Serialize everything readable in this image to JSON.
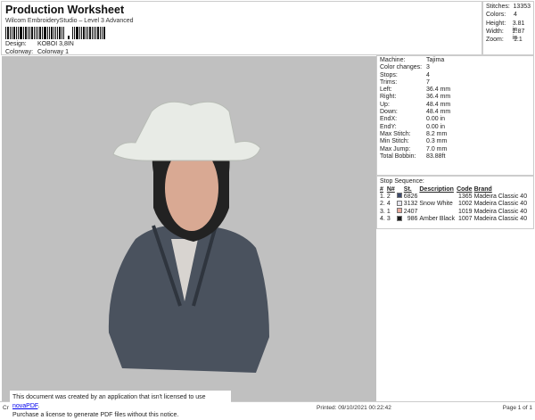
{
  "header": {
    "title": "Production Worksheet",
    "subtitle": "Wilcom EmbroideryStudio – Level 3 Advanced",
    "design_label": "Design:",
    "design_value": "KOBOI 3,8IN",
    "colorway_label": "Colorway:",
    "colorway_value": "Colorway 1"
  },
  "stats": [
    {
      "label": "Stitches:",
      "value": "13353"
    },
    {
      "label": "Colors:",
      "value": "4"
    },
    {
      "label": "Height:",
      "value": "3.81 in"
    },
    {
      "label": "Width:",
      "value": "2.87 in"
    },
    {
      "label": "Zoom:",
      "value": "1:1"
    }
  ],
  "machine": [
    {
      "label": "Machine:",
      "value": "Tajima"
    },
    {
      "label": "Color changes:",
      "value": "3"
    },
    {
      "label": "Stops:",
      "value": "4"
    },
    {
      "label": "Trims:",
      "value": "7"
    },
    {
      "label": "Left:",
      "value": "36.4 mm"
    },
    {
      "label": "Right:",
      "value": "36.4 mm"
    },
    {
      "label": "Up:",
      "value": "48.4 mm"
    },
    {
      "label": "Down:",
      "value": "48.4 mm"
    },
    {
      "label": "EndX:",
      "value": "0.00 in"
    },
    {
      "label": "EndY:",
      "value": "0.00 in"
    },
    {
      "label": "Max Stitch:",
      "value": "8.2 mm"
    },
    {
      "label": "Min Stitch:",
      "value": "0.3 mm"
    },
    {
      "label": "Max Jump:",
      "value": "7.0 mm"
    },
    {
      "label": "Total Bobbin:",
      "value": "83.88ft"
    }
  ],
  "sequence": {
    "title": "Stop Sequence:",
    "headers": [
      "#",
      "N#",
      "St.",
      "Description",
      "Code",
      "Brand"
    ],
    "rows": [
      {
        "n": "1.",
        "nn": "2",
        "color": "#3d4a6b",
        "st": "6826",
        "desc": "",
        "code": "1365",
        "brand": "Madeira Classic 40"
      },
      {
        "n": "2.",
        "nn": "4",
        "color": "#e6e6ee",
        "st": "3132",
        "desc": "Snow White",
        "code": "1002",
        "brand": "Madeira Classic 40"
      },
      {
        "n": "3.",
        "nn": "1",
        "color": "#e8a89a",
        "st": "2407",
        "desc": "",
        "code": "1019",
        "brand": "Madeira Classic 40"
      },
      {
        "n": "4.",
        "nn": "3",
        "color": "#1a1a1a",
        "st": "986",
        "desc": "Amber Black",
        "code": "1007",
        "brand": "Madeira Classic 40"
      }
    ]
  },
  "footer": {
    "left": "Cr",
    "printed": "Printed: 09/10/2021 00:22:42",
    "page": "Page 1 of 1"
  },
  "notice": {
    "line1": "This document was created by an application that isn't licensed to use ",
    "link": "novaPDF",
    "line1_end": ".",
    "line2": "Purchase a license to generate PDF files without this notice."
  }
}
